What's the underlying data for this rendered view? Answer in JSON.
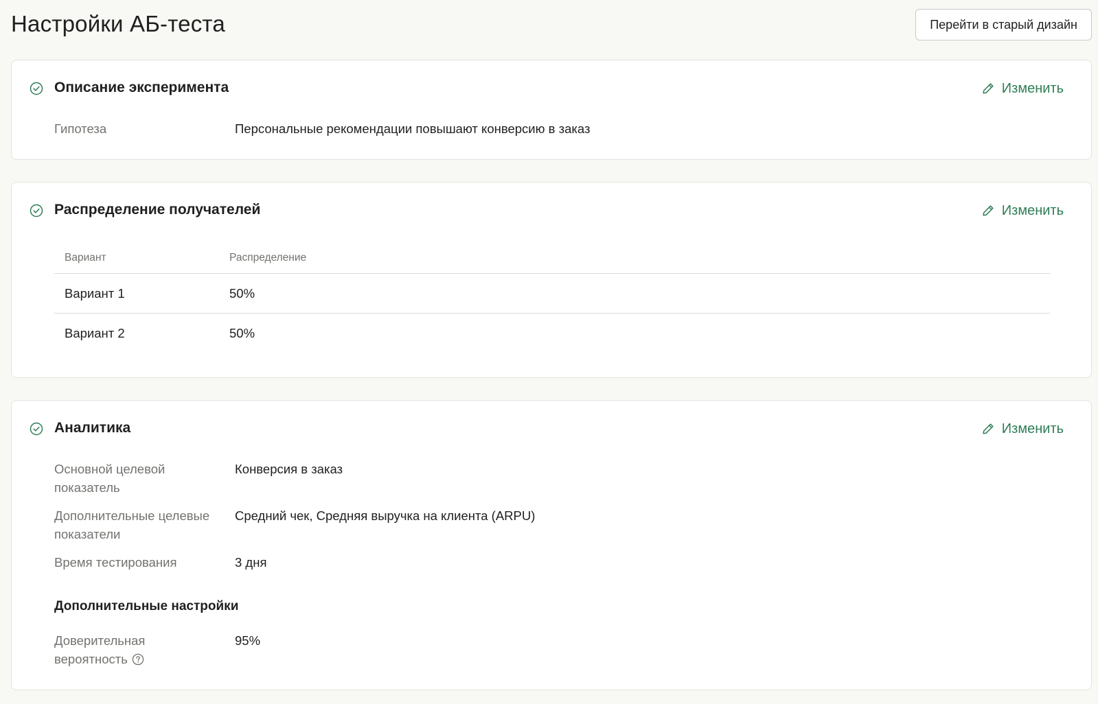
{
  "header": {
    "title": "Настройки АБ-теста",
    "old_design_button": "Перейти в старый дизайн"
  },
  "colors": {
    "accent": "#2f7d55",
    "background": "#f8f8f5",
    "muted_text": "#72726e"
  },
  "icons": {
    "section_status": "check-circle-icon",
    "edit": "pencil-icon",
    "help": "question-circle-icon"
  },
  "sections": {
    "description": {
      "title": "Описание эксперимента",
      "edit_label": "Изменить",
      "fields": [
        {
          "label": "Гипотеза",
          "value": "Персональные рекомендации повышают конверсию в заказ"
        }
      ]
    },
    "distribution": {
      "title": "Распределение получателей",
      "edit_label": "Изменить",
      "columns": [
        "Вариант",
        "Распределение"
      ],
      "rows": [
        [
          "Вариант 1",
          "50%"
        ],
        [
          "Вариант 2",
          "50%"
        ]
      ]
    },
    "analytics": {
      "title": "Аналитика",
      "edit_label": "Изменить",
      "fields": [
        {
          "label": "Основной целевой показатель",
          "value": "Конверсия в заказ"
        },
        {
          "label": "Дополнительные целевые показатели",
          "value": "Средний чек, Средняя выручка на клиента (ARPU)"
        },
        {
          "label": "Время тестирования",
          "value": "3 дня"
        }
      ],
      "extra_settings_title": "Дополнительные настройки",
      "extra_fields": [
        {
          "label": "Доверительная вероятность",
          "value": "95%"
        }
      ]
    }
  }
}
